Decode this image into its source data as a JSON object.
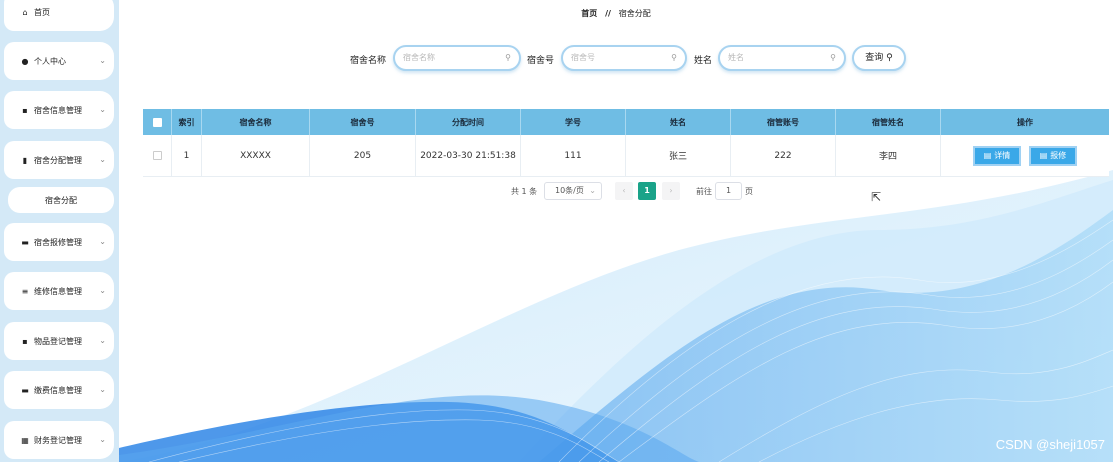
{
  "sidebar": {
    "items": [
      {
        "label": "首页",
        "icon": "home-icon",
        "glyph": "⌂"
      },
      {
        "label": "个人中心",
        "icon": "user-icon",
        "glyph": "●"
      },
      {
        "label": "宿舍信息管理",
        "icon": "grid-icon",
        "glyph": "▪"
      },
      {
        "label": "宿舍分配管理",
        "icon": "trash-icon",
        "glyph": "▮"
      },
      {
        "label": "宿舍报修管理",
        "icon": "folder-icon",
        "glyph": "▬"
      },
      {
        "label": "维修信息管理",
        "icon": "list-icon",
        "glyph": "≡"
      },
      {
        "label": "物品登记管理",
        "icon": "grid-icon",
        "glyph": "▪"
      },
      {
        "label": "缴费信息管理",
        "icon": "message-icon",
        "glyph": "▬"
      },
      {
        "label": "财务登记管理",
        "icon": "apps-icon",
        "glyph": "▦"
      }
    ],
    "sub_item": "宿舍分配"
  },
  "breadcrumb": {
    "home": "首页",
    "separator": "//",
    "current": "宿舍分配"
  },
  "search": {
    "dorm_name_label": "宿舍名称",
    "dorm_name_placeholder": "宿舍名称",
    "dorm_no_label": "宿舍号",
    "dorm_no_placeholder": "宿舍号",
    "name_label": "姓名",
    "name_placeholder": "姓名",
    "query_button": "查询"
  },
  "table": {
    "headers": [
      "",
      "索引",
      "宿舍名称",
      "宿舍号",
      "分配时间",
      "学号",
      "姓名",
      "宿管账号",
      "宿管姓名",
      "操作"
    ],
    "rows": [
      {
        "index": "1",
        "dorm_name": "XXXXX",
        "dorm_no": "205",
        "time": "2022-03-30 21:51:38",
        "student_no": "111",
        "name": "张三",
        "manager_account": "222",
        "manager_name": "李四"
      }
    ],
    "detail_button": "详情",
    "repair_button": "报修"
  },
  "pagination": {
    "total": "共 1 条",
    "page_size": "10条/页",
    "current_page": "1",
    "goto_label": "前往",
    "goto_value": "1",
    "page_suffix": "页"
  },
  "watermark": "CSDN @sheji1057",
  "colors": {
    "accent": "#6fbde4",
    "button": "#3aa8e8",
    "page_active": "#1aa389",
    "sidebar_bg": "#d4e9f7"
  }
}
